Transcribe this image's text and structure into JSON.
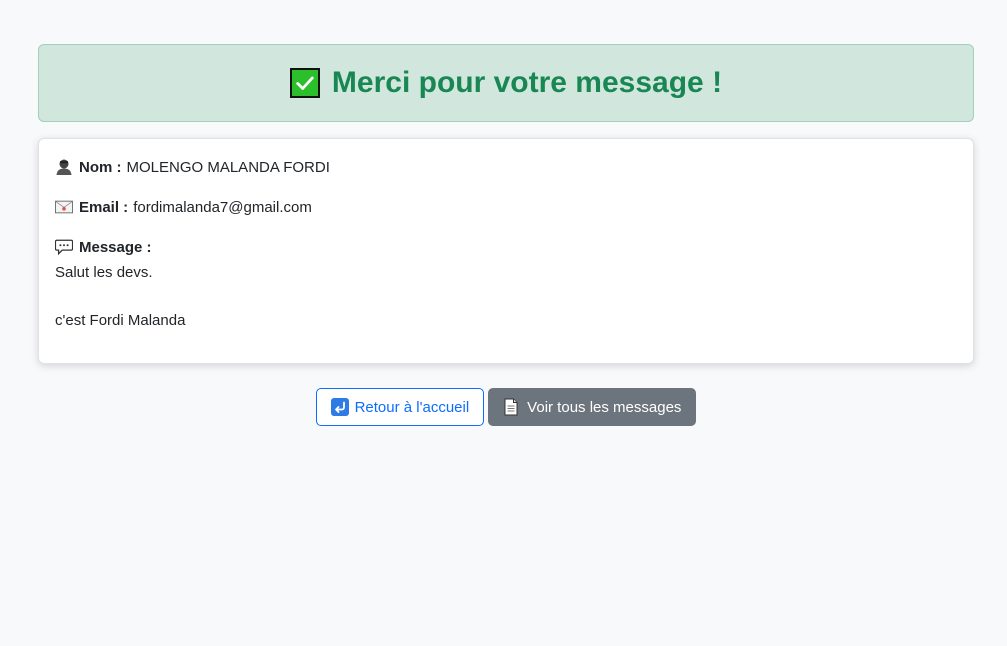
{
  "alert": {
    "title": "Merci pour votre message !",
    "icon": "check-mark-icon"
  },
  "details": {
    "name": {
      "label": "Nom :",
      "value": "MOLENGO MALANDA FORDI",
      "icon": "user-silhouette-icon"
    },
    "email": {
      "label": "Email :",
      "value": "fordimalanda7@gmail.com",
      "icon": "envelope-icon"
    },
    "message": {
      "label": "Message :",
      "value": "Salut les devs.\n\nc'est Fordi Malanda",
      "icon": "speech-bubble-icon"
    }
  },
  "actions": {
    "home_label": "Retour à l'accueil",
    "home_icon": "return-arrow-icon",
    "all_messages_label": "Voir tous les messages",
    "all_messages_icon": "page-icon"
  },
  "colors": {
    "success_bg": "#d1e7dd",
    "success_text": "#198754",
    "primary": "#0d6efd",
    "secondary": "#6c757d"
  }
}
